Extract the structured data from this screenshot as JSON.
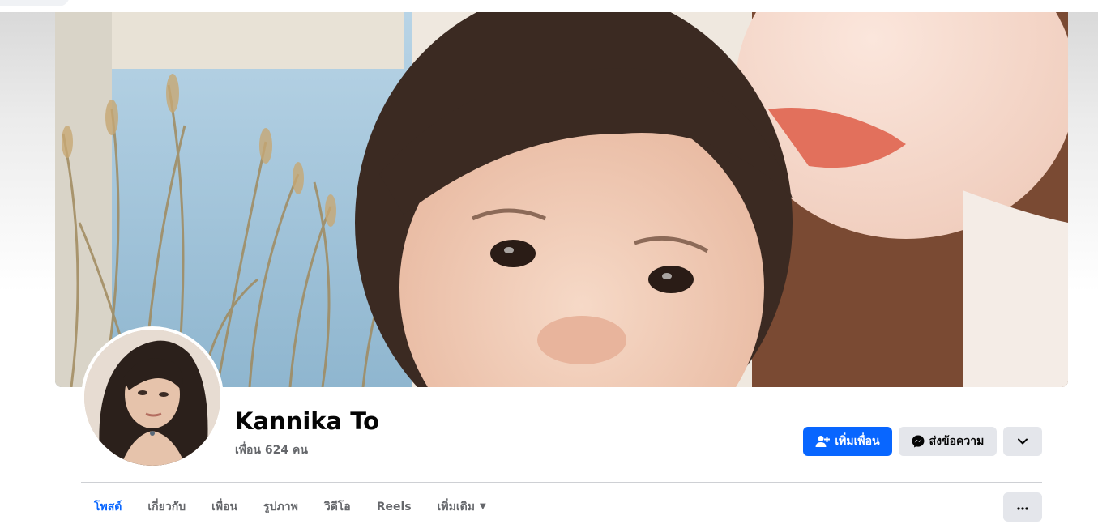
{
  "profile": {
    "name": "Kannika To",
    "friends_text": "เพื่อน 624 คน"
  },
  "actions": {
    "add_friend_label": "เพิ่มเพื่อน",
    "message_label": "ส่งข้อความ"
  },
  "tabs": [
    {
      "label": "โพสต์",
      "active": true
    },
    {
      "label": "เกี่ยวกับ",
      "active": false
    },
    {
      "label": "เพื่อน",
      "active": false
    },
    {
      "label": "รูปภาพ",
      "active": false
    },
    {
      "label": "วิดีโอ",
      "active": false
    },
    {
      "label": "Reels",
      "active": false
    },
    {
      "label": "เพิ่มเติม",
      "active": false
    }
  ],
  "icons": {
    "add_friend": "person-plus-icon",
    "message": "messenger-icon",
    "dropdown": "chevron-down-icon",
    "tab_more": "caret-down-icon",
    "more": "ellipsis-icon"
  },
  "colors": {
    "primary": "#0866ff",
    "secondary_bg": "#e4e6eb",
    "muted_text": "#65676b",
    "text": "#050505"
  }
}
